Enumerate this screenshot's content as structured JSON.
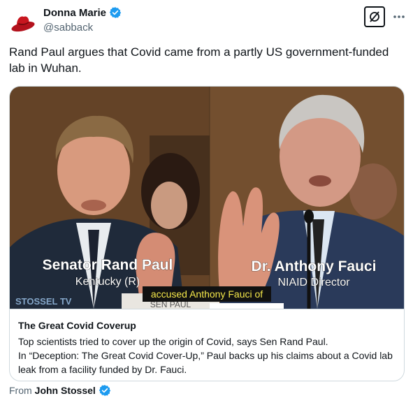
{
  "author": {
    "display_name": "Donna Marie",
    "handle": "@sabback",
    "avatar_icon": "red-cowboy-hat-icon",
    "verified": true
  },
  "header_actions": {
    "grok_icon": "grok-icon",
    "more_icon": "more-dots-icon"
  },
  "tweet": {
    "text": "Rand Paul argues that Covid came from a partly US government-funded lab in Wuhan."
  },
  "card": {
    "media": {
      "left_caption_name": "Senator Rand Paul",
      "left_caption_sub": "Kentucky (R)",
      "right_caption_name": "Dr. Anthony Fauci",
      "right_caption_sub": "NIAID Director",
      "subtitle": "accused Anthony Fauci of",
      "watermark": "STOSSEL TV",
      "nameplate": "SEN PAUL"
    },
    "title": "The Great Covid Coverup",
    "description_line1": "Top scientists tried to cover up the origin of Covid, says Sen Rand Paul.",
    "description_line2": "In “Deception: The Great Covid Cover-Up,” Paul backs up his claims about a Covid lab leak from a facility funded by Dr. Fauci."
  },
  "from": {
    "prefix": "From",
    "name": "John Stossel",
    "verified": true
  },
  "colors": {
    "verified_blue": "#1d9bf0",
    "text_primary": "#0f1419",
    "text_secondary": "#536471",
    "border": "#cfd9de",
    "subtitle_yellow": "#f5e84a"
  }
}
